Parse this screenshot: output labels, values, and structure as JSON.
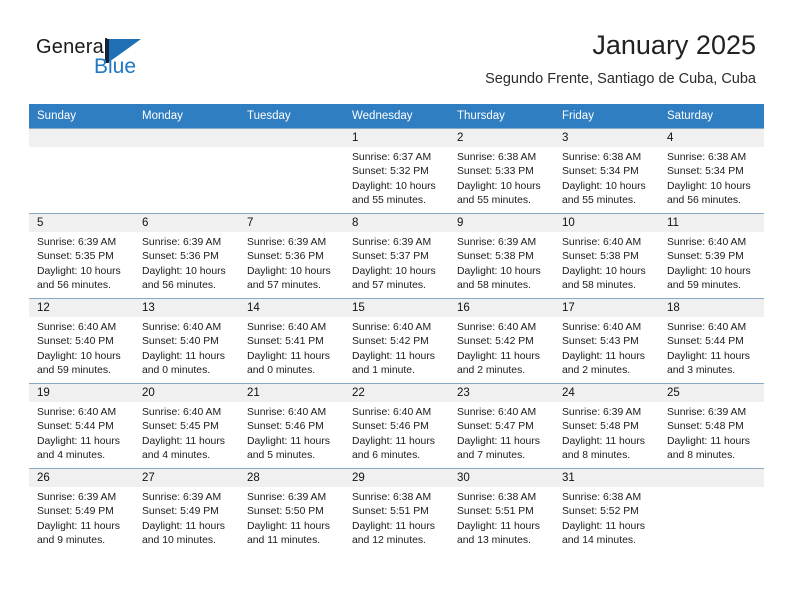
{
  "brand": {
    "name_part1": "General",
    "name_part2": "Blue",
    "accent_color": "#1f78c1",
    "flag_color": "#1f6fb5"
  },
  "header": {
    "title": "January 2025",
    "subtitle": "Segundo Frente, Santiago de Cuba, Cuba"
  },
  "calendar": {
    "header_color": "#2f7ec1",
    "weekday_headers": [
      "Sunday",
      "Monday",
      "Tuesday",
      "Wednesday",
      "Thursday",
      "Friday",
      "Saturday"
    ],
    "weeks": [
      [
        {
          "day": "",
          "lines": []
        },
        {
          "day": "",
          "lines": []
        },
        {
          "day": "",
          "lines": []
        },
        {
          "day": "1",
          "lines": [
            "Sunrise: 6:37 AM",
            "Sunset: 5:32 PM",
            "Daylight: 10 hours",
            "and 55 minutes."
          ]
        },
        {
          "day": "2",
          "lines": [
            "Sunrise: 6:38 AM",
            "Sunset: 5:33 PM",
            "Daylight: 10 hours",
            "and 55 minutes."
          ]
        },
        {
          "day": "3",
          "lines": [
            "Sunrise: 6:38 AM",
            "Sunset: 5:34 PM",
            "Daylight: 10 hours",
            "and 55 minutes."
          ]
        },
        {
          "day": "4",
          "lines": [
            "Sunrise: 6:38 AM",
            "Sunset: 5:34 PM",
            "Daylight: 10 hours",
            "and 56 minutes."
          ]
        }
      ],
      [
        {
          "day": "5",
          "lines": [
            "Sunrise: 6:39 AM",
            "Sunset: 5:35 PM",
            "Daylight: 10 hours",
            "and 56 minutes."
          ]
        },
        {
          "day": "6",
          "lines": [
            "Sunrise: 6:39 AM",
            "Sunset: 5:36 PM",
            "Daylight: 10 hours",
            "and 56 minutes."
          ]
        },
        {
          "day": "7",
          "lines": [
            "Sunrise: 6:39 AM",
            "Sunset: 5:36 PM",
            "Daylight: 10 hours",
            "and 57 minutes."
          ]
        },
        {
          "day": "8",
          "lines": [
            "Sunrise: 6:39 AM",
            "Sunset: 5:37 PM",
            "Daylight: 10 hours",
            "and 57 minutes."
          ]
        },
        {
          "day": "9",
          "lines": [
            "Sunrise: 6:39 AM",
            "Sunset: 5:38 PM",
            "Daylight: 10 hours",
            "and 58 minutes."
          ]
        },
        {
          "day": "10",
          "lines": [
            "Sunrise: 6:40 AM",
            "Sunset: 5:38 PM",
            "Daylight: 10 hours",
            "and 58 minutes."
          ]
        },
        {
          "day": "11",
          "lines": [
            "Sunrise: 6:40 AM",
            "Sunset: 5:39 PM",
            "Daylight: 10 hours",
            "and 59 minutes."
          ]
        }
      ],
      [
        {
          "day": "12",
          "lines": [
            "Sunrise: 6:40 AM",
            "Sunset: 5:40 PM",
            "Daylight: 10 hours",
            "and 59 minutes."
          ]
        },
        {
          "day": "13",
          "lines": [
            "Sunrise: 6:40 AM",
            "Sunset: 5:40 PM",
            "Daylight: 11 hours",
            "and 0 minutes."
          ]
        },
        {
          "day": "14",
          "lines": [
            "Sunrise: 6:40 AM",
            "Sunset: 5:41 PM",
            "Daylight: 11 hours",
            "and 0 minutes."
          ]
        },
        {
          "day": "15",
          "lines": [
            "Sunrise: 6:40 AM",
            "Sunset: 5:42 PM",
            "Daylight: 11 hours",
            "and 1 minute."
          ]
        },
        {
          "day": "16",
          "lines": [
            "Sunrise: 6:40 AM",
            "Sunset: 5:42 PM",
            "Daylight: 11 hours",
            "and 2 minutes."
          ]
        },
        {
          "day": "17",
          "lines": [
            "Sunrise: 6:40 AM",
            "Sunset: 5:43 PM",
            "Daylight: 11 hours",
            "and 2 minutes."
          ]
        },
        {
          "day": "18",
          "lines": [
            "Sunrise: 6:40 AM",
            "Sunset: 5:44 PM",
            "Daylight: 11 hours",
            "and 3 minutes."
          ]
        }
      ],
      [
        {
          "day": "19",
          "lines": [
            "Sunrise: 6:40 AM",
            "Sunset: 5:44 PM",
            "Daylight: 11 hours",
            "and 4 minutes."
          ]
        },
        {
          "day": "20",
          "lines": [
            "Sunrise: 6:40 AM",
            "Sunset: 5:45 PM",
            "Daylight: 11 hours",
            "and 4 minutes."
          ]
        },
        {
          "day": "21",
          "lines": [
            "Sunrise: 6:40 AM",
            "Sunset: 5:46 PM",
            "Daylight: 11 hours",
            "and 5 minutes."
          ]
        },
        {
          "day": "22",
          "lines": [
            "Sunrise: 6:40 AM",
            "Sunset: 5:46 PM",
            "Daylight: 11 hours",
            "and 6 minutes."
          ]
        },
        {
          "day": "23",
          "lines": [
            "Sunrise: 6:40 AM",
            "Sunset: 5:47 PM",
            "Daylight: 11 hours",
            "and 7 minutes."
          ]
        },
        {
          "day": "24",
          "lines": [
            "Sunrise: 6:39 AM",
            "Sunset: 5:48 PM",
            "Daylight: 11 hours",
            "and 8 minutes."
          ]
        },
        {
          "day": "25",
          "lines": [
            "Sunrise: 6:39 AM",
            "Sunset: 5:48 PM",
            "Daylight: 11 hours",
            "and 8 minutes."
          ]
        }
      ],
      [
        {
          "day": "26",
          "lines": [
            "Sunrise: 6:39 AM",
            "Sunset: 5:49 PM",
            "Daylight: 11 hours",
            "and 9 minutes."
          ]
        },
        {
          "day": "27",
          "lines": [
            "Sunrise: 6:39 AM",
            "Sunset: 5:49 PM",
            "Daylight: 11 hours",
            "and 10 minutes."
          ]
        },
        {
          "day": "28",
          "lines": [
            "Sunrise: 6:39 AM",
            "Sunset: 5:50 PM",
            "Daylight: 11 hours",
            "and 11 minutes."
          ]
        },
        {
          "day": "29",
          "lines": [
            "Sunrise: 6:38 AM",
            "Sunset: 5:51 PM",
            "Daylight: 11 hours",
            "and 12 minutes."
          ]
        },
        {
          "day": "30",
          "lines": [
            "Sunrise: 6:38 AM",
            "Sunset: 5:51 PM",
            "Daylight: 11 hours",
            "and 13 minutes."
          ]
        },
        {
          "day": "31",
          "lines": [
            "Sunrise: 6:38 AM",
            "Sunset: 5:52 PM",
            "Daylight: 11 hours",
            "and 14 minutes."
          ]
        },
        {
          "day": "",
          "lines": []
        }
      ]
    ]
  }
}
